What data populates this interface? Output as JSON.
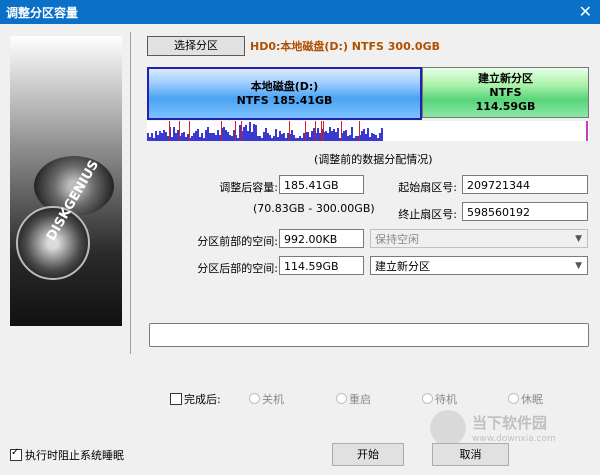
{
  "window": {
    "title": "调整分区容量",
    "close_glyph": "✕"
  },
  "side": {
    "brand": "DISKGENIUS"
  },
  "select_partition_button": "选择分区",
  "disk_info": "HD0:本地磁盘(D:) NTFS 300.0GB",
  "partitions": [
    {
      "line1": "本地磁盘(D:)",
      "line2": "NTFS 185.41GB"
    },
    {
      "line1": "建立新分区",
      "line2": "NTFS",
      "line3": "114.59GB"
    }
  ],
  "map_caption": "(调整前的数据分配情况)",
  "form": {
    "size_label": "调整后容量:",
    "size_value": "185.41GB",
    "range": "(70.83GB - 300.00GB)",
    "start_sector_label": "起始扇区号:",
    "start_sector_value": "209721344",
    "end_sector_label": "终止扇区号:",
    "end_sector_value": "598560192",
    "before_label": "分区前部的空间:",
    "before_value": "992.00KB",
    "before_option": "保持空闲",
    "after_label": "分区后部的空间:",
    "after_value": "114.59GB",
    "after_option": "建立新分区"
  },
  "result_text": "",
  "finish": {
    "label": "完成后:",
    "options": [
      "关机",
      "重启",
      "待机",
      "休眠"
    ]
  },
  "prevent_sleep_label": "执行时阻止系统睡眠",
  "buttons": {
    "start": "开始",
    "cancel": "取消"
  },
  "watermark": {
    "title": "当下软件园",
    "url": "www.downxia.com"
  },
  "colors": {
    "titlebar": "#0a70c8",
    "disk_info": "#b05000",
    "map_bar": "#3a3ad0",
    "map_mark": "#d02020"
  }
}
